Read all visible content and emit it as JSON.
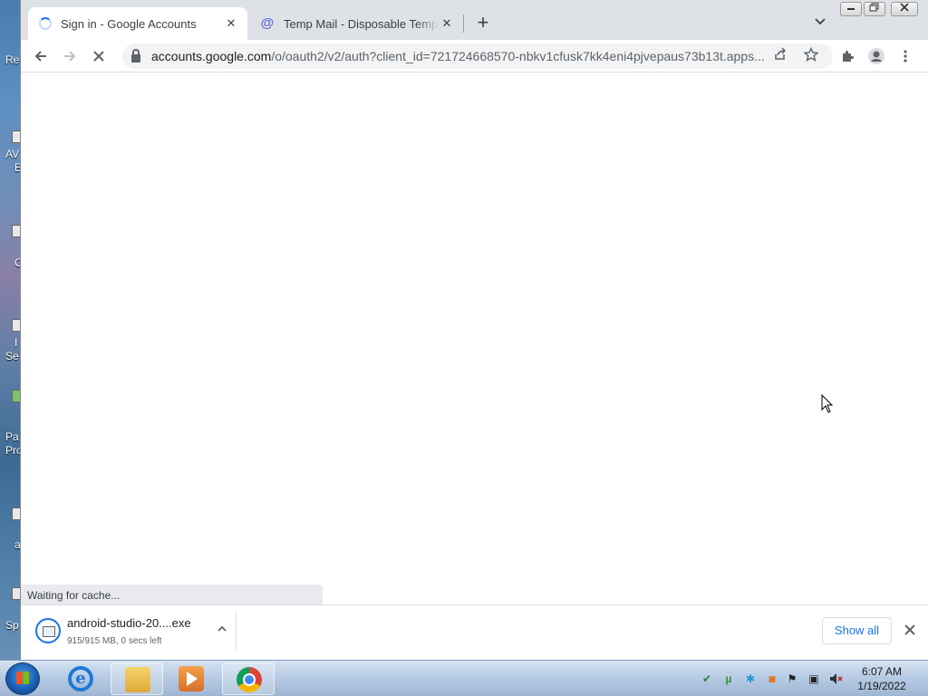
{
  "desktop": {
    "fragments": [
      "Re",
      "AV",
      "E",
      "C",
      "I",
      "Se",
      "Pa",
      "Pro",
      "a",
      "Sp"
    ]
  },
  "browser": {
    "tabs": [
      {
        "title": "Sign in - Google Accounts",
        "icon": "loading-spinner",
        "active": true
      },
      {
        "title": "Temp Mail - Disposable Temporary Email",
        "icon": "at-sign-icon",
        "active": false
      }
    ],
    "new_tab": "+",
    "tab_search": "⌄",
    "window_controls": {
      "minimize": "—",
      "restore": "❐",
      "close": "✕"
    },
    "toolbar": {
      "back": "←",
      "forward": "→",
      "stop": "✕"
    },
    "address": {
      "host": "accounts.google.com",
      "path": "/o/oauth2/v2/auth?client_id=721724668570-nbkv1cfusk7kk4eni4pjvepaus73b13t.apps..."
    },
    "status_text": "Waiting for cache..."
  },
  "download_bar": {
    "filename": "android-studio-20....exe",
    "status": "915/915 MB, 0 secs left",
    "show_all": "Show all",
    "close": "✕"
  },
  "taskbar": {
    "apps": [
      "internet-explorer",
      "windows-explorer",
      "media-player",
      "google-chrome"
    ],
    "clock": {
      "time": "6:07 AM",
      "date": "1/19/2022"
    }
  }
}
